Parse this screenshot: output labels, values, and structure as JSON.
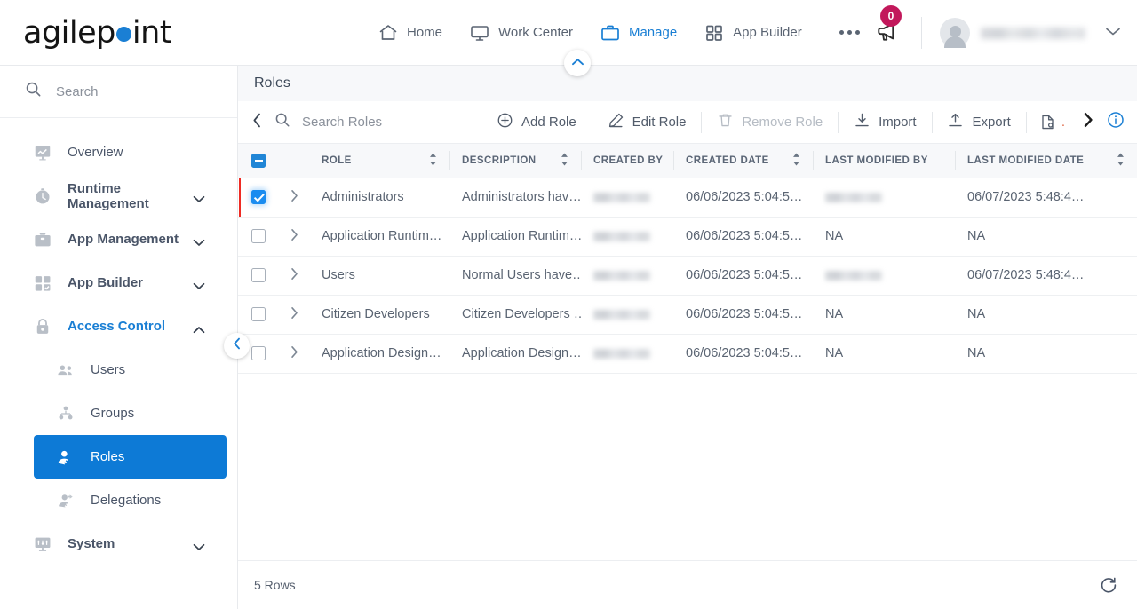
{
  "brand": {
    "name_part1": "agilep",
    "name_part2": "int",
    "accent": "#1a7fd4"
  },
  "topnav": {
    "items": [
      {
        "label": "Home",
        "icon": "home-icon",
        "active": false
      },
      {
        "label": "Work Center",
        "icon": "monitor-icon",
        "active": false
      },
      {
        "label": "Manage",
        "icon": "briefcase-icon",
        "active": true
      },
      {
        "label": "App Builder",
        "icon": "grid-icon",
        "active": false
      }
    ],
    "overflow_label": "more-options",
    "notification_count": "0",
    "user_name": "",
    "active_color": "#1a7fd4"
  },
  "sidebar": {
    "search": {
      "placeholder": "Search"
    },
    "items": [
      {
        "label": "Overview",
        "icon": "chart-monitor-icon",
        "expandable": false,
        "state": "normal"
      },
      {
        "label": "Runtime Management",
        "icon": "clock-icon",
        "expandable": true,
        "state": "bold"
      },
      {
        "label": "App Management",
        "icon": "toolbox-icon",
        "expandable": true,
        "state": "bold"
      },
      {
        "label": "App Builder",
        "icon": "grid-check-icon",
        "expandable": true,
        "state": "bold"
      },
      {
        "label": "Access Control",
        "icon": "lock-icon",
        "expandable": true,
        "state": "accent",
        "expanded": true
      }
    ],
    "subitems": [
      {
        "label": "Users",
        "icon": "users-icon",
        "selected": false
      },
      {
        "label": "Groups",
        "icon": "group-icon",
        "selected": false
      },
      {
        "label": "Roles",
        "icon": "role-person-icon",
        "selected": true
      },
      {
        "label": "Delegations",
        "icon": "delegation-person-icon",
        "selected": false
      }
    ],
    "footer_item": {
      "label": "System",
      "icon": "system-monitor-icon",
      "expandable": true
    },
    "selected_color": "#0d7ad6"
  },
  "page": {
    "title": "Roles"
  },
  "toolbar": {
    "back_icon": "chevron-left-icon",
    "search": {
      "placeholder": "Search Roles",
      "icon": "search-icon"
    },
    "buttons": [
      {
        "label": "Add Role",
        "icon": "plus-circle-icon",
        "disabled": false
      },
      {
        "label": "Edit Role",
        "icon": "pencil-icon",
        "disabled": false
      },
      {
        "label": "Remove Role",
        "icon": "trash-icon",
        "disabled": true
      },
      {
        "label": "Import",
        "icon": "download-icon",
        "disabled": false
      },
      {
        "label": "Export",
        "icon": "upload-icon",
        "disabled": false
      }
    ],
    "overflow_icon": "document-settings-icon",
    "scroll_right_icon": "chevron-right-icon",
    "info_icon": "info-circle-icon"
  },
  "table": {
    "select_all_state": "indeterminate",
    "columns": [
      {
        "label": "ROLE",
        "sortable": true
      },
      {
        "label": "DESCRIPTION",
        "sortable": true
      },
      {
        "label": "CREATED BY",
        "sortable": false
      },
      {
        "label": "CREATED DATE",
        "sortable": true
      },
      {
        "label": "LAST MODIFIED BY",
        "sortable": false
      },
      {
        "label": "LAST MODIFIED DATE",
        "sortable": true
      }
    ],
    "rows": [
      {
        "checked": true,
        "highlighted": true,
        "role": "Administrators",
        "description": "Administrators hav…",
        "created_by": "",
        "created_by_blurred": true,
        "created_date": "06/06/2023 5:04:5…",
        "last_modified_by": "",
        "last_modified_by_blurred": true,
        "last_modified_date": "06/07/2023 5:48:4…"
      },
      {
        "checked": false,
        "highlighted": false,
        "role": "Application Runtim…",
        "description": "Application Runtim…",
        "created_by": "",
        "created_by_blurred": true,
        "created_date": "06/06/2023 5:04:5…",
        "last_modified_by": "NA",
        "last_modified_by_blurred": false,
        "last_modified_date": "NA"
      },
      {
        "checked": false,
        "highlighted": false,
        "role": "Users",
        "description": "Normal Users have…",
        "created_by": "",
        "created_by_blurred": true,
        "created_date": "06/06/2023 5:04:5…",
        "last_modified_by": "",
        "last_modified_by_blurred": true,
        "last_modified_date": "06/07/2023 5:48:4…"
      },
      {
        "checked": false,
        "highlighted": false,
        "role": "Citizen Developers",
        "description": "Citizen Developers …",
        "created_by": "",
        "created_by_blurred": true,
        "created_date": "06/06/2023 5:04:5…",
        "last_modified_by": "NA",
        "last_modified_by_blurred": false,
        "last_modified_date": "NA"
      },
      {
        "checked": false,
        "highlighted": false,
        "role": "Application Design…",
        "description": "Application Design…",
        "created_by": "",
        "created_by_blurred": true,
        "created_date": "06/06/2023 5:04:5…",
        "last_modified_by": "NA",
        "last_modified_by_blurred": false,
        "last_modified_date": "NA"
      }
    ],
    "footer": {
      "row_count_label": "5 Rows",
      "refresh_icon": "refresh-icon"
    }
  },
  "annotation": {
    "highlight_color": "#ee2b24",
    "target": "row-checkbox-administrators"
  }
}
